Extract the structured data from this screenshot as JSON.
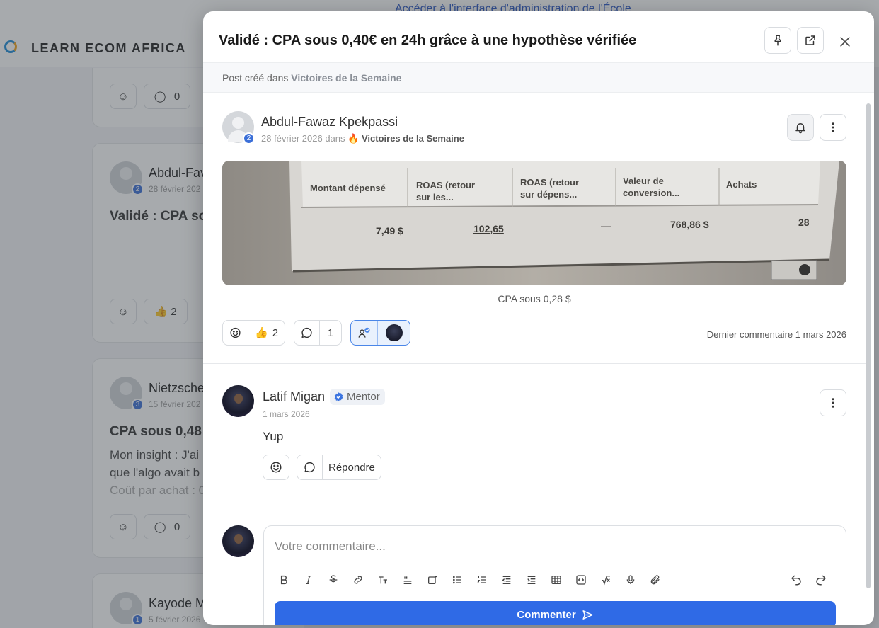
{
  "background": {
    "admin_link": "Accéder à l'interface d'administration de l'École",
    "brand": "LEARN ECOM AFRICA",
    "cards": [
      {
        "author": "Abdul-Fawaz Kpekpassi",
        "author_short": "Abdul-Fav",
        "date": "28 février 2026",
        "date_short": "28 février 202",
        "badge": "2",
        "title_short": "Validé : CPA so",
        "reaction_count": "2"
      },
      {
        "author": "Nietzsche",
        "author_short": "Nietzsche",
        "date": "15 février 202",
        "badge": "3",
        "title_short": "CPA sous 0,48",
        "text_lines": [
          "Mon insight : J'ai",
          "que l'algo avait b",
          "Coût par achat : 0"
        ],
        "comment_count": "0"
      },
      {
        "author": "Kayode M",
        "author_short": "Kayode M",
        "date": "5 février 2026",
        "badge": "1"
      }
    ],
    "top_card_comment_count": "0"
  },
  "modal": {
    "title": "Validé : CPA sous 0,40€ en 24h grâce à une hypothèse vérifiée",
    "posted_prefix": "Post créé dans",
    "space": "Victoires de la Semaine",
    "icons": {
      "pin": "pin-icon",
      "open": "external-link-icon",
      "close": "close-icon"
    },
    "post": {
      "author": "Abdul-Fawaz Kpekpassi",
      "badge": "2",
      "date_prefix": "28 février 2026 dans",
      "space": "Victoires de la Semaine",
      "image": {
        "headers": [
          "Montant dépensé",
          "ROAS (retour sur les...",
          "ROAS (retour sur dépens...",
          "Valeur de conversion...",
          "Achats"
        ],
        "values": [
          "7,49 $",
          "102,65",
          "—",
          "768,86 $",
          "28"
        ]
      },
      "caption": "CPA sous 0,28 $",
      "reactions": {
        "emoji": "👍",
        "count": "2"
      },
      "comments": "1",
      "last_comment": "Dernier commentaire 1 mars 2026"
    },
    "comment": {
      "author": "Latif Migan",
      "role": "Mentor",
      "date": "1 mars 2026",
      "body": "Yup",
      "reply_label": "Répondre"
    },
    "editor": {
      "placeholder": "Votre commentaire...",
      "submit_label": "Commenter"
    }
  }
}
